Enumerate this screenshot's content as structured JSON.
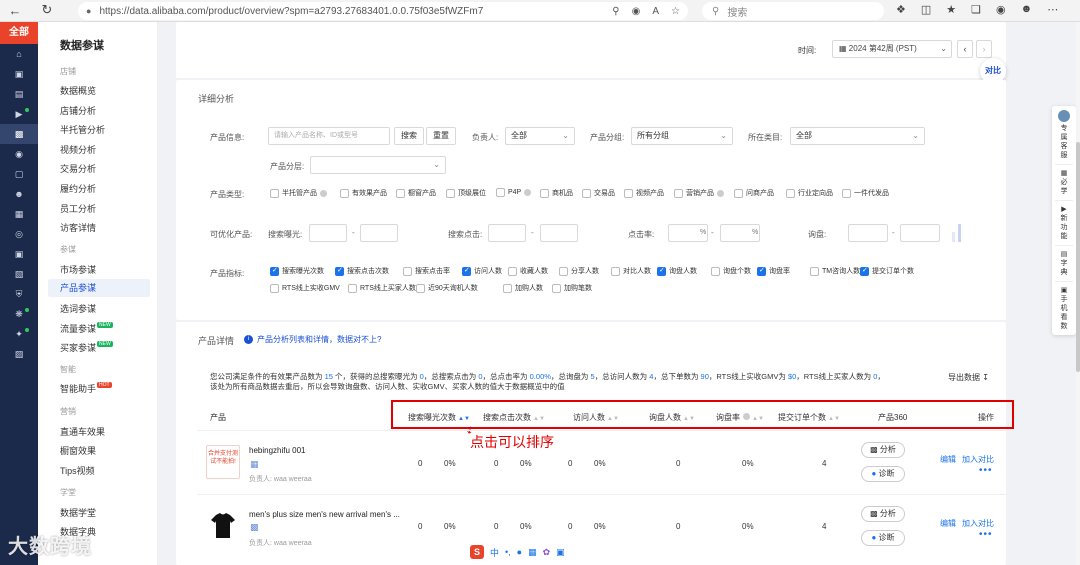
{
  "browser": {
    "url": "https://data.alibaba.com/product/overview?spm=a2793.27683401.0.0.75f03e5fWZFm7",
    "search_placeholder": "搜索"
  },
  "rail": {
    "all_label": "全部"
  },
  "subnav": {
    "title": "数据参谋",
    "groups": [
      {
        "label": "店铺",
        "items": [
          "数据概览",
          "店铺分析",
          "半托管分析",
          "视频分析",
          "交易分析",
          "履约分析",
          "员工分析",
          "访客详情"
        ]
      },
      {
        "label": "参谋",
        "items": [
          "市场参谋",
          "产品参谋",
          "选词参谋",
          "流量参谋",
          "买家参谋"
        ]
      },
      {
        "label": "智能",
        "items": [
          "智能助手"
        ]
      },
      {
        "label": "营销",
        "items": [
          "直通车效果",
          "橱窗效果",
          "Tips视频"
        ]
      },
      {
        "label": "学堂",
        "items": [
          "数据学堂",
          "数据字典"
        ]
      }
    ],
    "active_item": "产品参谋",
    "new_badge": "NEW",
    "hot_badge": "HOT"
  },
  "header": {
    "time_label": "时间:",
    "time_value": "2024 第42周 (PST)",
    "compare_label": "对比"
  },
  "filters": {
    "section_title": "详细分析",
    "product_info_label": "产品信息:",
    "product_info_placeholder": "请输入产品名称、ID或型号",
    "search_btn": "搜索",
    "reset_btn": "重置",
    "owner_label": "负责人:",
    "owner_value": "全部",
    "group_label": "产品分组:",
    "group_value": "所有分组",
    "category_label": "所在类目:",
    "category_value": "全部",
    "tier_label": "产品分层:",
    "type_label": "产品类型:",
    "types": [
      "半托管产品",
      "有效果产品",
      "橱窗产品",
      "顶级展位",
      "P4P",
      "商机品",
      "交易品",
      "视频产品",
      "营销产品",
      "问商产品",
      "行业定向品",
      "一件代发品"
    ],
    "optimizable_label": "可优化产品:",
    "exposure_label": "搜索曝光:",
    "click_label": "搜索点击:",
    "ctr_label": "点击率:",
    "inquiry_label": "询盘:",
    "dash": "-",
    "percent": "%",
    "metrics_label": "产品指标:",
    "metrics": [
      {
        "label": "搜索曝光次数",
        "checked": true
      },
      {
        "label": "搜索点击次数",
        "checked": true
      },
      {
        "label": "搜索点击率",
        "checked": false
      },
      {
        "label": "访问人数",
        "checked": true
      },
      {
        "label": "收藏人数",
        "checked": false
      },
      {
        "label": "分享人数",
        "checked": false
      },
      {
        "label": "对比人数",
        "checked": false
      },
      {
        "label": "询盘人数",
        "checked": true
      },
      {
        "label": "询盘个数",
        "checked": false
      },
      {
        "label": "询盘率",
        "checked": true
      },
      {
        "label": "TM咨询人数",
        "checked": false
      },
      {
        "label": "提交订单个数",
        "checked": true
      },
      {
        "label": "RTS线上实收GMV",
        "checked": false
      },
      {
        "label": "RTS线上买家人数",
        "checked": false
      },
      {
        "label": "近90天询机人数",
        "checked": false
      },
      {
        "label": "加购人数",
        "checked": false
      },
      {
        "label": "加购笔数",
        "checked": false
      }
    ]
  },
  "details": {
    "section_title": "产品详情",
    "hint": "产品分析列表和详情，数据对不上?",
    "summary_line1_parts": [
      "您公司满足条件的有效果产品数为 ",
      "15",
      " 个，获得的总搜索曝光为 ",
      "0",
      "，总搜索点击为 ",
      "0",
      "，总点击率为 ",
      "0.00%",
      "，总询盘为 ",
      "5",
      "，总访问人数为 ",
      "4",
      "，总下单数为 ",
      "90",
      "，RTS线上实收GMV为 ",
      "$0",
      "，RTS线上买家人数为 ",
      "0",
      "，"
    ],
    "summary_line2": "该处为所有商品数据去重后，所以会导致询盘数、访问人数、实收GMV、买家人数的值大于数据概览中的值",
    "export_label": "导出数据",
    "columns": [
      "产品",
      "搜索曝光次数",
      "搜索点击次数",
      "访问人数",
      "询盘人数",
      "询盘率",
      "提交订单个数",
      "产品360",
      "操作"
    ],
    "annotation": "点击可以排序",
    "rows": [
      {
        "name": "hebingzhifu 001",
        "owner": "负责人: waa weeraa",
        "thumb_text": "合并支付测试不能拍!",
        "exposure": "0",
        "exposure_pct": "0%",
        "clicks": "0",
        "clicks_pct": "0%",
        "visitors": "0",
        "visitors_pct": "0%",
        "inquirers": "0",
        "inquiry_rate": "0%",
        "orders": "4",
        "analyze": "分析",
        "diagnose": "诊断",
        "edit": "编辑",
        "add_compare": "加入对比",
        "more": "•••"
      },
      {
        "name": "men's plus size men's new arrival men's ...",
        "owner": "负责人: waa weeraa",
        "thumb_text": "",
        "exposure": "0",
        "exposure_pct": "0%",
        "clicks": "0",
        "clicks_pct": "0%",
        "visitors": "0",
        "visitors_pct": "0%",
        "inquirers": "0",
        "inquiry_rate": "0%",
        "orders": "4",
        "analyze": "分析",
        "diagnose": "诊断",
        "edit": "编辑",
        "add_compare": "加入对比",
        "more": "•••"
      }
    ]
  },
  "right_float": [
    "专属客服",
    "必学",
    "新功能",
    "字典",
    "手机看数"
  ],
  "watermark": "大数跨境",
  "ime_label": "中"
}
